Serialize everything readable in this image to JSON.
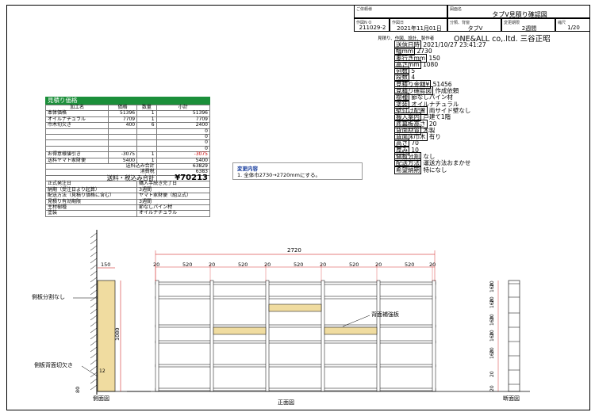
{
  "title_block": {
    "customer_label": "ご依頼様",
    "drawing_name_label": "図面名",
    "drawing_name": "タブV見積り確認図",
    "order_no_label": "作図N O",
    "order_no": "211029-2",
    "date_label": "作図日",
    "date": "2021年11月01日",
    "category_label": "分類、背窗",
    "category": "タブV",
    "change_label": "変更期限",
    "change": "2週間",
    "page_label": "縮尺",
    "page": "1/20",
    "maker_label": "見積り、作図、設計、製作者",
    "maker": "ONE&ALL co,.ltd. 三谷正昭"
  },
  "specs": [
    {
      "k": "送信日時",
      "v": "2021/10/27 23:41:27"
    },
    {
      "k": "幅mm",
      "v": "2730"
    },
    {
      "k": "奥行きmm",
      "v": "150"
    },
    {
      "k": "高さmm",
      "v": "1080"
    },
    {
      "k": "列数",
      "v": "5"
    },
    {
      "k": "段数",
      "v": "4"
    },
    {
      "k": "見積り金額¥",
      "v": "51456"
    },
    {
      "k": "見積り確認図",
      "v": "作成依頼"
    },
    {
      "k": "樹種",
      "v": "節なしパイン材"
    },
    {
      "k": "塗装",
      "v": "オイルナチュラル"
    },
    {
      "k": "壁付け配置",
      "v": "両サイド壁なし"
    },
    {
      "k": "搬入案内",
      "v": "戸建て1階"
    },
    {
      "k": "底幕板高さ",
      "v": "20"
    },
    {
      "k": "背面材質",
      "v": "木製"
    },
    {
      "k": "背面床巾木",
      "v": "有り"
    },
    {
      "k": "高さ",
      "v": "70"
    },
    {
      "k": "厚み",
      "v": "10"
    },
    {
      "k": "側板分割",
      "v": "なし"
    },
    {
      "k": "配送方法",
      "v": "運送方法おまかせ"
    },
    {
      "k": "希望納期",
      "v": "特になし"
    }
  ],
  "price": {
    "title": "見積り価格",
    "headers": [
      "加工名",
      "価格",
      "数量",
      "小計"
    ],
    "rows": [
      [
        "本体価格",
        "51396",
        "1",
        "51396"
      ],
      [
        "オイルナチュラル",
        "7709",
        "1",
        "7709"
      ],
      [
        "巾木切欠き",
        "400",
        "6",
        "2400"
      ],
      [
        "",
        "",
        "",
        "0"
      ],
      [
        "",
        "",
        "",
        "0"
      ],
      [
        "",
        "",
        "",
        "0"
      ],
      [
        "",
        "",
        "",
        "0"
      ],
      [
        "お得意様値引き",
        "-3075",
        "1",
        "-3075"
      ],
      [
        "送料ヤマト家財便",
        "5400",
        "1",
        "5400"
      ]
    ],
    "subtotal_label": "送料込み合計",
    "subtotal": "63829",
    "tax_label": "消費税",
    "tax": "6383",
    "total_label": "送料・税込み合計",
    "total": "¥70213",
    "info": [
      [
        "正式発注日",
        "購入手続き完了日"
      ],
      [
        "納期（受注日より起算）",
        "3週間"
      ],
      [
        "配送方法（見積り価格に含む）",
        "ヤマト家財便（組立式）"
      ],
      [
        "見積り有効期限",
        "3週間"
      ],
      [
        "主材樹種",
        "節なしパイン材"
      ],
      [
        "塗装",
        "オイルナチュラル"
      ]
    ]
  },
  "change_note": {
    "title": "変更内容",
    "text": "1. 全体巾2730→2720mmにする。"
  },
  "side_view": {
    "width_dim": "150",
    "height_dim": "1080",
    "base_dim": "80",
    "notch_dim": "12",
    "note1": "側板分割なし",
    "note2": "側板背面切欠き",
    "label": "側面図"
  },
  "front_view": {
    "total_width": "2720",
    "segments": [
      "20",
      "520",
      "20",
      "520",
      "20",
      "520",
      "20",
      "520",
      "20",
      "520",
      "20"
    ],
    "note": "背面補強板",
    "label": "正面図"
  },
  "section_view": {
    "dims": [
      "20",
      "160",
      "20",
      "160",
      "20",
      "160",
      "20",
      "160",
      "20",
      "160",
      "20",
      "20"
    ],
    "label": "断面図"
  }
}
